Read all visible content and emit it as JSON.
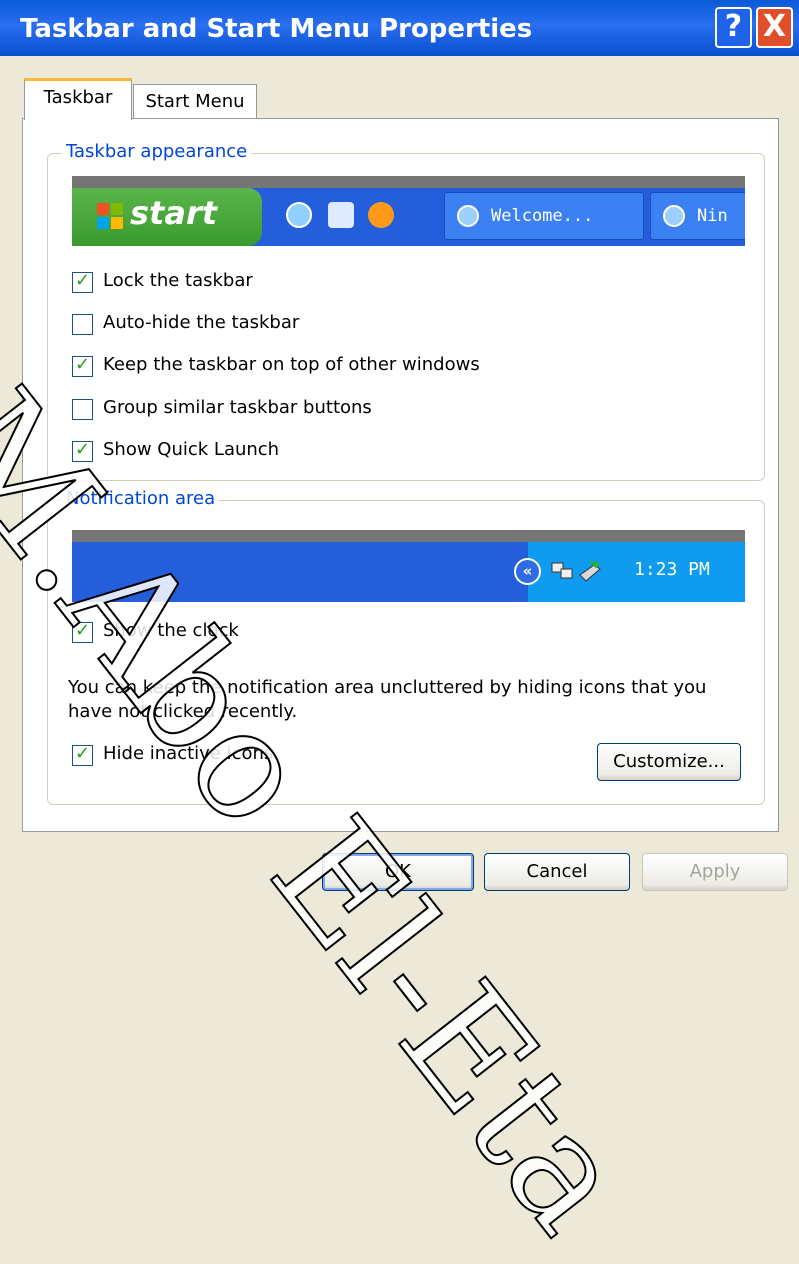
{
  "window": {
    "title": "Taskbar and Start Menu Properties",
    "help_label": "?",
    "close_label": "X"
  },
  "tabs": [
    {
      "label": "Taskbar",
      "active": true
    },
    {
      "label": "Start Menu",
      "active": false
    }
  ],
  "taskbar_appearance": {
    "legend": "Taskbar appearance",
    "preview": {
      "start_label": "start",
      "tasks": [
        "Welcome...",
        "Nin"
      ]
    },
    "options": [
      {
        "label": "Lock the taskbar",
        "checked": true
      },
      {
        "label": "Auto-hide the taskbar",
        "checked": false
      },
      {
        "label": "Keep the taskbar on top of other windows",
        "checked": true
      },
      {
        "label": "Group similar taskbar buttons",
        "checked": false
      },
      {
        "label": "Show Quick Launch",
        "checked": true
      }
    ]
  },
  "notification_area": {
    "legend": "Notification area",
    "preview": {
      "clock": "1:23 PM",
      "chevron": "«"
    },
    "show_clock": {
      "label": "Show the clock",
      "checked": true
    },
    "description": "You can keep the notification area uncluttered by hiding icons that you have not clicked recently.",
    "hide_inactive": {
      "label": "Hide inactive icons",
      "checked": true
    },
    "customize_label": "Customize..."
  },
  "buttons": {
    "ok": "OK",
    "cancel": "Cancel",
    "apply": "Apply"
  },
  "watermark": "M.Abo El-Eta"
}
